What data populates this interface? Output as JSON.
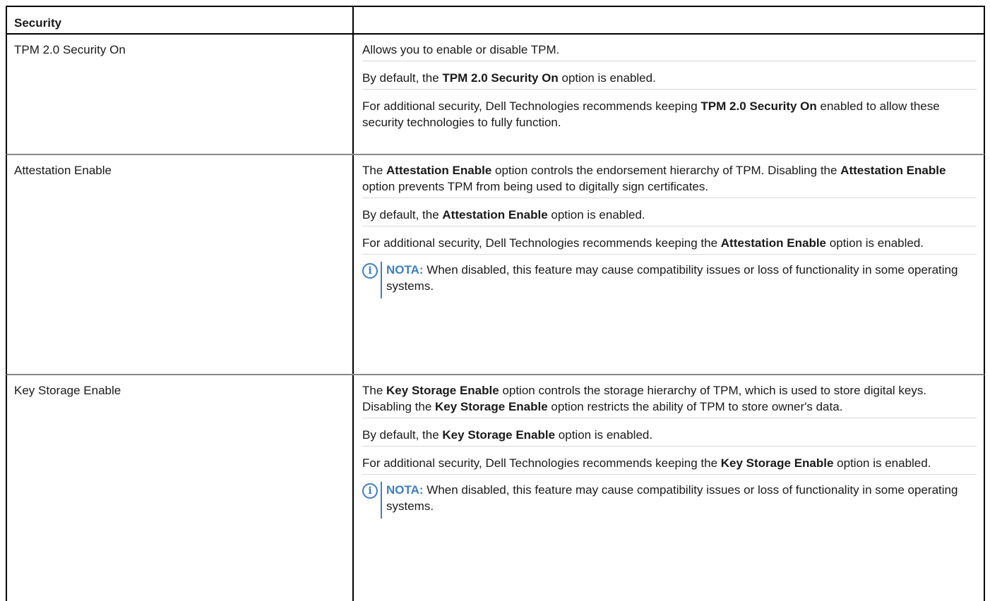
{
  "table": {
    "header": {
      "left": "Security",
      "right": ""
    },
    "rows": [
      {
        "name": "TPM 2.0 Security On",
        "paragraphs": [
          {
            "text": "Allows you to enable or disable TPM."
          },
          {
            "pre": "By default, the ",
            "bold": "TPM 2.0 Security On",
            "post": " option is enabled."
          },
          {
            "pre": "For additional security, Dell Technologies recommends keeping ",
            "bold": "TPM 2.0 Security On",
            "post": " enabled to allow these security technologies to fully function."
          }
        ]
      },
      {
        "name": "Attestation Enable",
        "paragraphs": [
          {
            "pre": "The ",
            "bold": "Attestation Enable",
            "post": " option controls the endorsement hierarchy of TPM. Disabling the ",
            "bold2": "Attestation Enable",
            "post2": " option prevents TPM from being used to digitally sign certificates."
          },
          {
            "pre": "By default, the ",
            "bold": "Attestation Enable",
            "post": " option is enabled."
          },
          {
            "pre": "For additional security, Dell Technologies recommends keeping the ",
            "bold": "Attestation Enable",
            "post": " option is enabled."
          }
        ],
        "note": {
          "label": "NOTA:",
          "text": " When disabled, this feature may cause compatibility issues or loss of functionality in some operating systems."
        }
      },
      {
        "name": "Key Storage Enable",
        "paragraphs": [
          {
            "pre": "The ",
            "bold": "Key Storage Enable",
            "post": " option controls the storage hierarchy of TPM, which is used to store digital keys. Disabling the ",
            "bold2": "Key Storage Enable",
            "post2": " option restricts the ability of TPM to store owner's data."
          },
          {
            "pre": "By default, the ",
            "bold": "Key Storage Enable",
            "post": " option is enabled."
          },
          {
            "pre": "For additional security, Dell Technologies recommends keeping the ",
            "bold": "Key Storage Enable",
            "post": " option is enabled."
          }
        ],
        "note": {
          "label": "NOTA:",
          "text": " When disabled, this feature may cause compatibility issues or loss of functionality in some operating systems."
        }
      }
    ]
  },
  "icons": {
    "note": "info-icon",
    "note_glyph": "i"
  },
  "colors": {
    "note_accent": "#3d7fc2",
    "border": "#000000",
    "row_separator": "#888888"
  }
}
